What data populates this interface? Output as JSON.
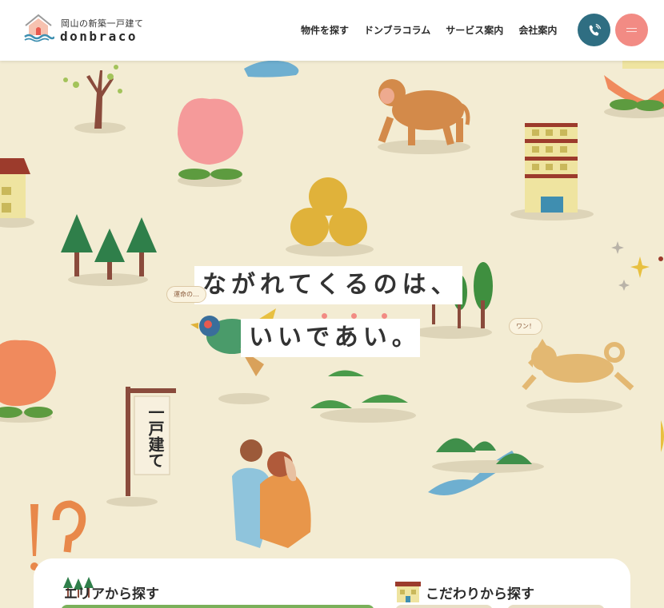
{
  "header": {
    "logo_tagline": "岡山の新築一戸建て",
    "logo_name": "donbraco",
    "logo_icon": "house-wave-icon",
    "nav": [
      "物件を探す",
      "ドンブラコラム",
      "サービス案内",
      "会社案内"
    ],
    "phone_icon": "phone-icon",
    "menu_icon": "hamburger-icon"
  },
  "hero": {
    "copy_line1": "ながれてくるのは、",
    "copy_line2": "いいであい。",
    "bird_bubble": "運命の…",
    "dog_bubble": "ワン！",
    "sign_text": "一戸建て"
  },
  "search": {
    "area_title": "エリアから探す",
    "area_icon": "trees-icon",
    "condition_title": "こだわりから探す",
    "condition_icon": "house-icon"
  },
  "colors": {
    "background": "#f3ecd3",
    "phone_button": "#2f6e82",
    "menu_button": "#f28b84",
    "accent_green": "#7ab05a"
  }
}
